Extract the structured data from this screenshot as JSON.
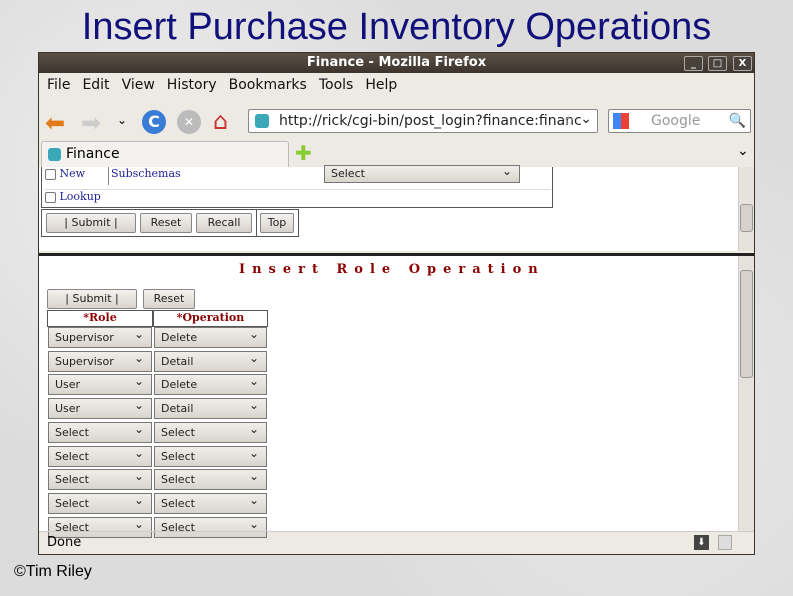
{
  "slide": {
    "title": "Insert Purchase Inventory Operations",
    "copyright": "©Tim Riley"
  },
  "window": {
    "title": "Finance - Mozilla Firefox",
    "minimize": "_",
    "maximize": "□",
    "close": "X"
  },
  "menu": [
    "File",
    "Edit",
    "View",
    "History",
    "Bookmarks",
    "Tools",
    "Help"
  ],
  "nav": {
    "url": "http://rick/cgi-bin/post_login?finance:financ",
    "search_placeholder": "Google"
  },
  "tab": {
    "label": "Finance"
  },
  "upper": {
    "new_label": "New",
    "lookup_label": "Lookup",
    "subschemas": "Subschemas",
    "select": "Select",
    "buttons": [
      "|   Submit   |",
      "Reset",
      "Recall",
      "Top"
    ]
  },
  "lower": {
    "heading": "Insert Role Operation",
    "buttons": [
      "|   Submit   |",
      "Reset"
    ],
    "headers": [
      "*Role",
      "*Operation"
    ],
    "rows": [
      [
        "Supervisor",
        "Delete"
      ],
      [
        "Supervisor",
        "Detail"
      ],
      [
        "User",
        "Delete"
      ],
      [
        "User",
        "Detail"
      ],
      [
        "Select",
        "Select"
      ],
      [
        "Select",
        "Select"
      ],
      [
        "Select",
        "Select"
      ],
      [
        "Select",
        "Select"
      ],
      [
        "Select",
        "Select"
      ]
    ]
  },
  "status": "Done",
  "colors": {
    "title": "#10107a",
    "heading": "#8b0000"
  }
}
